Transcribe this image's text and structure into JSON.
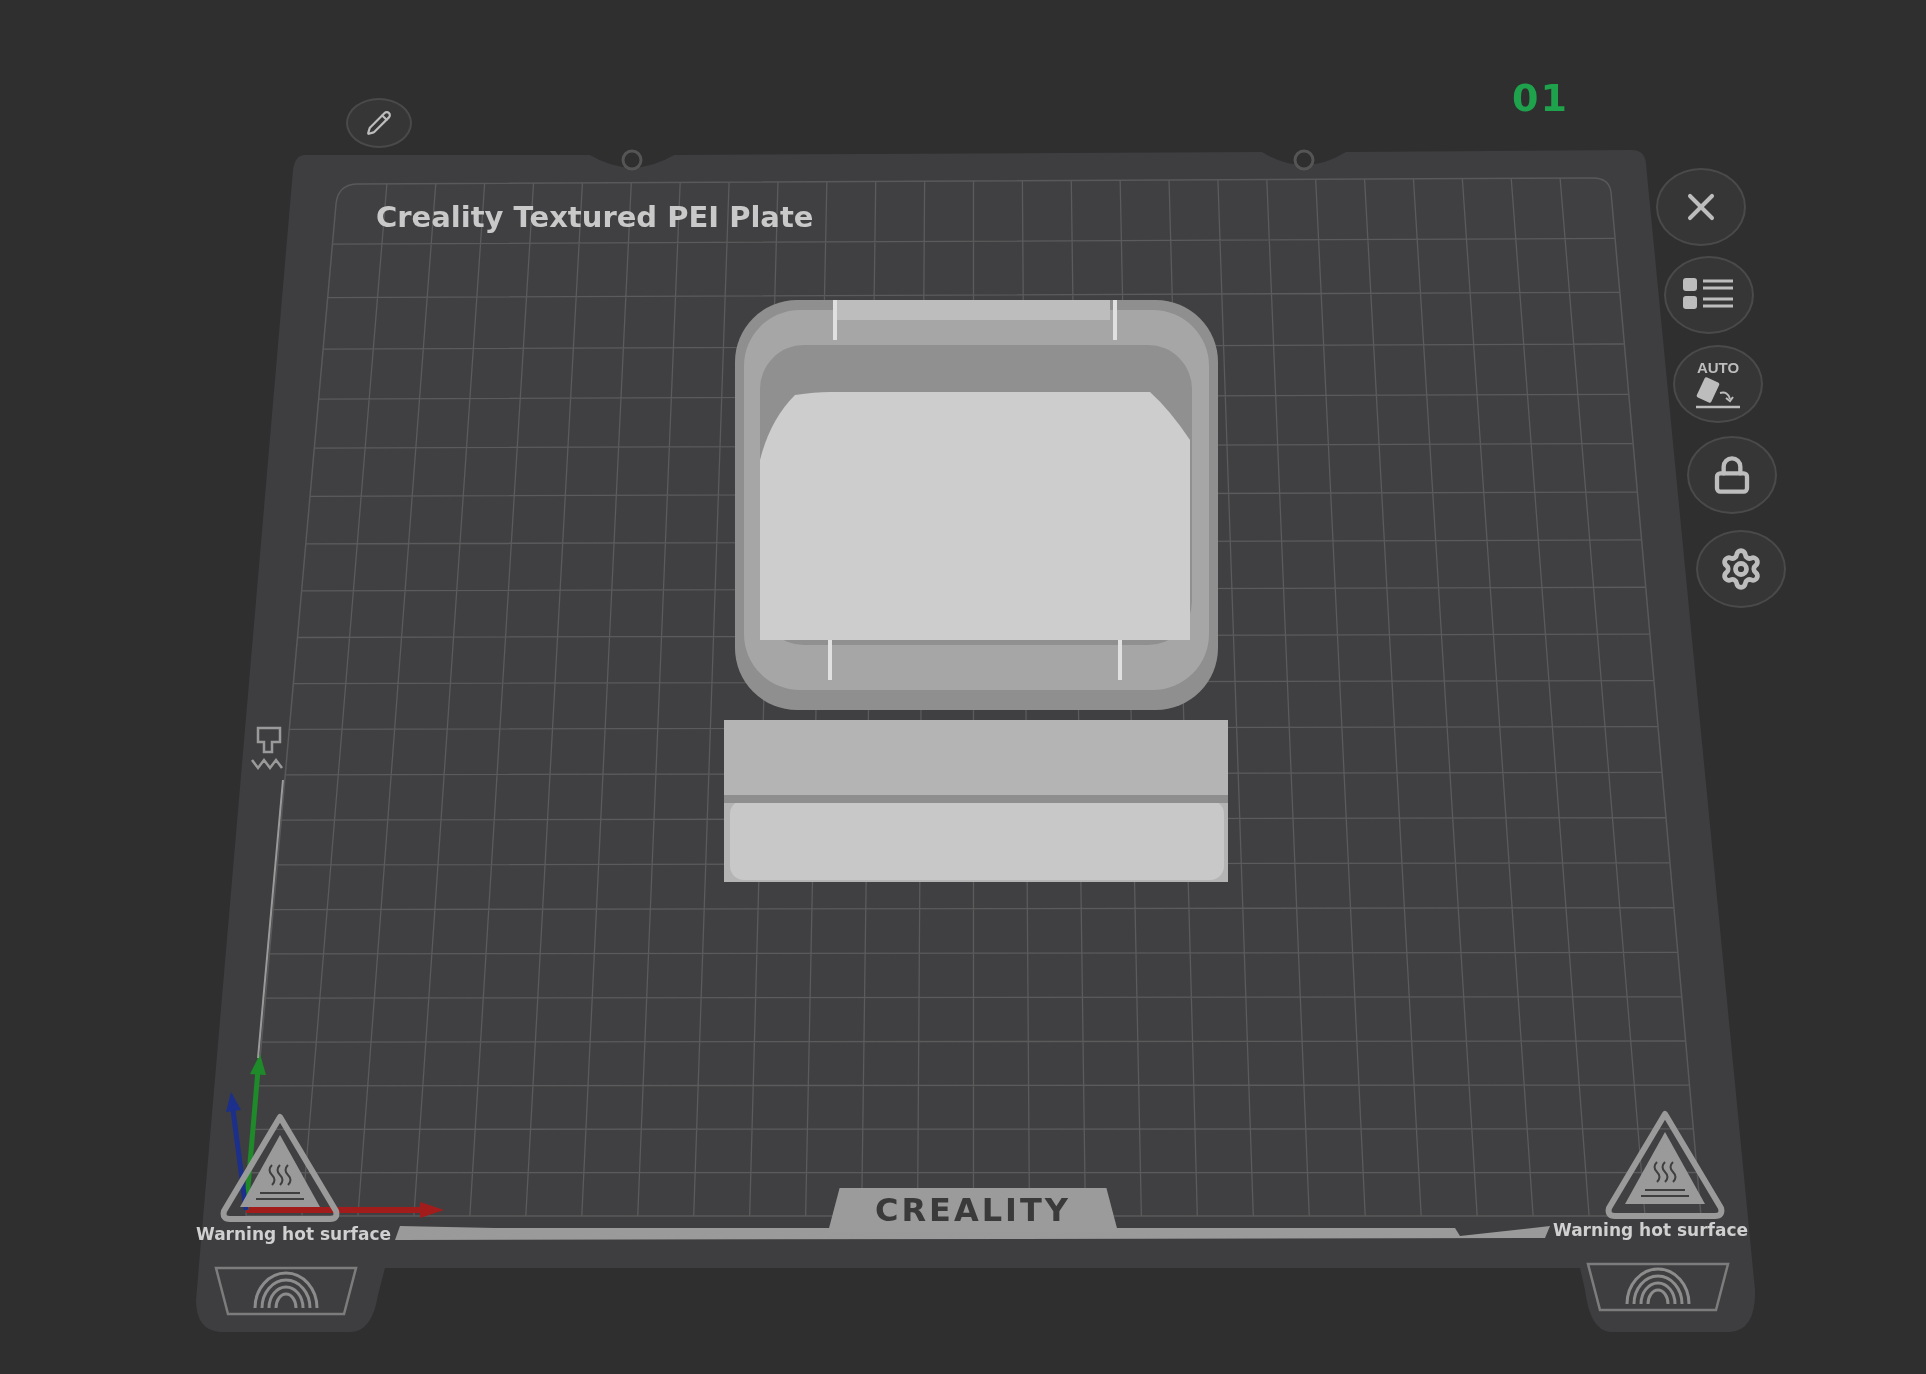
{
  "plate": {
    "number": "01",
    "name": "Creality Textured PEI Plate",
    "logo": "CREALITY"
  },
  "warnings": [
    "Warning hot surface",
    "Warning hot surface"
  ],
  "toolbar": [
    {
      "kind": "close"
    },
    {
      "kind": "list"
    },
    {
      "kind": "auto",
      "label": "AUTO"
    },
    {
      "kind": "lock"
    },
    {
      "kind": "settings"
    }
  ]
}
